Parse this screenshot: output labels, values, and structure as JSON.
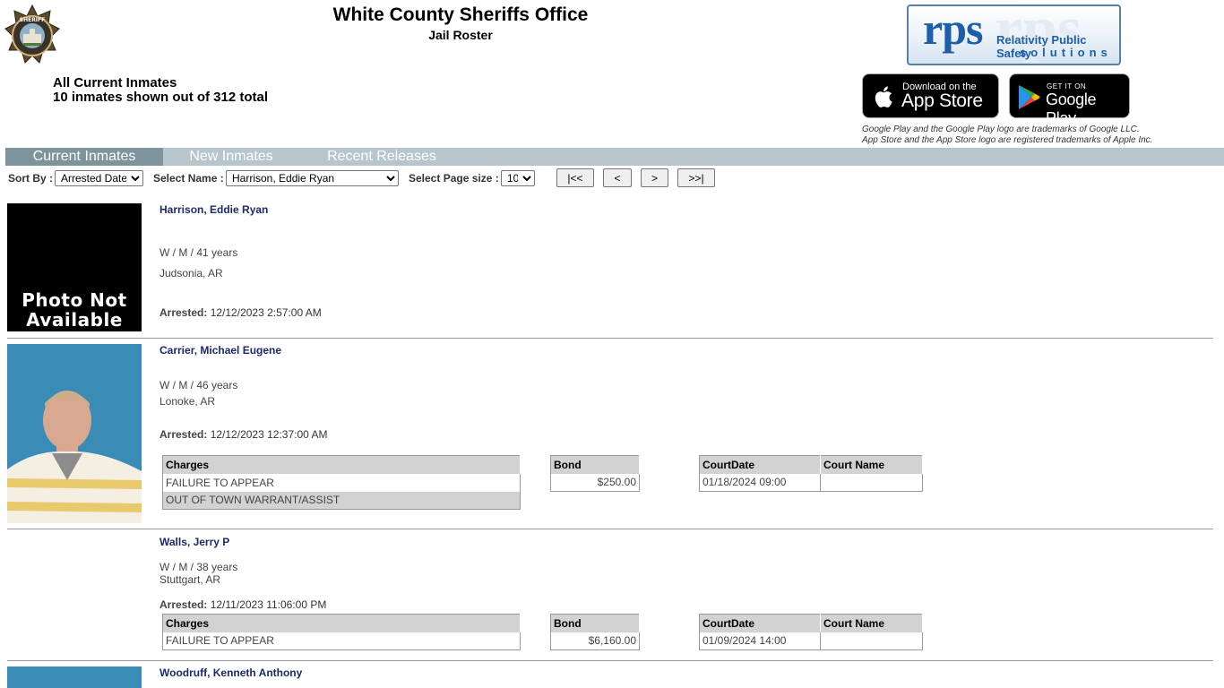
{
  "header": {
    "title": "White County Sheriffs Office",
    "subtitle": "Jail Roster",
    "summary_line1": "All Current Inmates",
    "summary_line2": "10 inmates shown out of 312 total",
    "badge_top_text": "SHERIFF",
    "badge_side_text": "WHITE COUNTY"
  },
  "brand": {
    "rps_logo_text": "rps",
    "rps_tagline_1": "Relativity Public Safety",
    "rps_tagline_2": "solutions",
    "appstore_small": "Download on the",
    "appstore_big": "App Store",
    "googleplay_small": "GET IT ON",
    "googleplay_big": "Google Play",
    "trademark_1": "Google Play and the Google Play logo are trademarks of Google LLC.",
    "trademark_2": "App Store and the App Store logo are registered trademarks of Apple Inc."
  },
  "tabs": {
    "current": "Current Inmates",
    "new": "New Inmates",
    "recent": "Recent Releases"
  },
  "controls": {
    "sort_label": "Sort By :",
    "sort_value": "Arrested Date",
    "name_label": "Select Name :",
    "name_value": "Harrison, Eddie Ryan",
    "pagesize_label": "Select Page size :",
    "pagesize_value": "10",
    "first": "|<<",
    "prev": "<",
    "next": ">",
    "last": ">>|"
  },
  "table_headers": {
    "charges": "Charges",
    "bond": "Bond",
    "courtdate": "CourtDate",
    "courtname": "Court Name"
  },
  "arrested_label": "Arrested:",
  "inmates": [
    {
      "name": "Harrison, Eddie Ryan",
      "demographics": "W / M / 41 years",
      "location": "Judsonia, AR",
      "arrested": "12/12/2023 2:57:00 AM",
      "photo_text_1": "Photo Not",
      "photo_text_2": "Available"
    },
    {
      "name": "Carrier, Michael Eugene",
      "demographics": "W / M / 46 years",
      "location": "Lonoke, AR",
      "arrested": "12/12/2023 12:37:00 AM",
      "charges": [
        "FAILURE TO APPEAR",
        "OUT OF TOWN WARRANT/ASSIST"
      ],
      "bond": "$250.00",
      "court_date": "01/18/2024 09:00",
      "court_name": ""
    },
    {
      "name": "Walls, Jerry P",
      "demographics": "W / M / 38 years",
      "location": "Stuttgart, AR",
      "arrested": "12/11/2023 11:06:00 PM",
      "charges": [
        "FAILURE TO APPEAR"
      ],
      "bond": "$6,160.00",
      "court_date": "01/09/2024 14:00",
      "court_name": ""
    },
    {
      "name": "Woodruff, Kenneth Anthony"
    }
  ]
}
